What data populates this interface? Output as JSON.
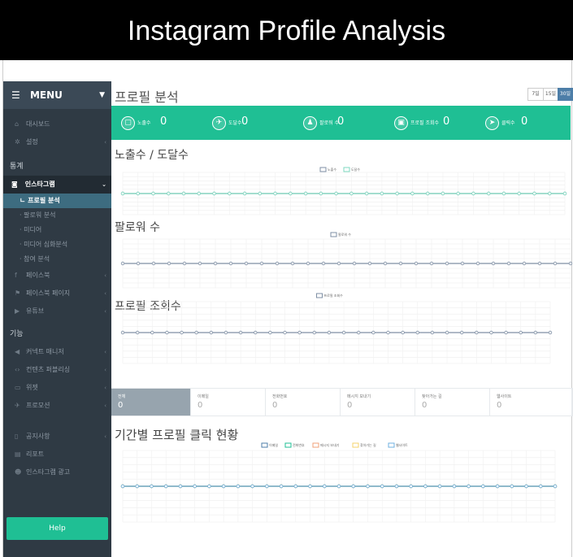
{
  "banner": {
    "title": "Instagram Profile Analysis"
  },
  "sidebar": {
    "menu_label": "MENU",
    "items_top": [
      {
        "icon": "home-icon",
        "glyph": "⌂",
        "label": "대시보드"
      },
      {
        "icon": "gear-icon",
        "glyph": "✲",
        "label": "설정"
      }
    ],
    "section_stats": "통계",
    "instagram": {
      "label": "인스타그램"
    },
    "instagram_sub": [
      "프로필 분석",
      "팔로워 분석",
      "미디어",
      "미디어 심화분석",
      "참여 분석"
    ],
    "items_mid": [
      {
        "icon": "facebook-icon",
        "glyph": "f",
        "label": "페이스북"
      },
      {
        "icon": "flag-icon",
        "glyph": "⚑",
        "label": "페이스북 페이지"
      },
      {
        "icon": "youtube-icon",
        "glyph": "▶",
        "label": "유튜브"
      }
    ],
    "section_features": "기능",
    "items_features": [
      {
        "icon": "megaphone-icon",
        "glyph": "◀",
        "label": "커넥트 매니저"
      },
      {
        "icon": "code-icon",
        "glyph": "‹›",
        "label": "컨텐츠 퍼블리싱"
      },
      {
        "icon": "chat-icon",
        "glyph": "▭",
        "label": "위젯"
      },
      {
        "icon": "rocket-icon",
        "glyph": "✈",
        "label": "프로모션"
      }
    ],
    "items_bottom": [
      {
        "icon": "document-icon",
        "glyph": "▯",
        "label": "공지사항"
      },
      {
        "icon": "report-icon",
        "glyph": "▤",
        "label": "리포트"
      },
      {
        "icon": "users-icon",
        "glyph": "☻",
        "label": "인스타그램 광고"
      }
    ],
    "help_label": "Help"
  },
  "page": {
    "title": "프로필 분석",
    "ranges": [
      "7일",
      "15일",
      "30일"
    ],
    "active_range": "30일"
  },
  "stats_bar": [
    {
      "icon": "tablet-icon",
      "glyph": "▢",
      "label": "노출수",
      "value": "0"
    },
    {
      "icon": "plane-icon",
      "glyph": "✈",
      "label": "도달수",
      "value": "0"
    },
    {
      "icon": "user-icon",
      "glyph": "♟",
      "label": "팔로워 수",
      "value": "0"
    },
    {
      "icon": "id-card-icon",
      "glyph": "▣",
      "label": "프로필 조회수",
      "value": "0"
    },
    {
      "icon": "cursor-icon",
      "glyph": "➤",
      "label": "클릭수",
      "value": "0"
    }
  ],
  "sections": {
    "impressions": "노출수 / 도달수",
    "followers": "팔로워 수",
    "profile_views": "프로필 조회수",
    "clicks": "기간별 프로필 클릭 현황"
  },
  "click_breakdown": [
    {
      "label": "전체",
      "value": "0"
    },
    {
      "label": "이메일",
      "value": "0"
    },
    {
      "label": "전화번호",
      "value": "0"
    },
    {
      "label": "메시지 보내기",
      "value": "0"
    },
    {
      "label": "찾아가는 길",
      "value": "0"
    },
    {
      "label": "웹사이트",
      "value": "0"
    }
  ],
  "chart_data": [
    {
      "type": "line",
      "series": [
        {
          "name": "노출수",
          "values": [
            0,
            0,
            0,
            0,
            0,
            0,
            0,
            0,
            0,
            0,
            0,
            0,
            0,
            0,
            0,
            0,
            0,
            0,
            0,
            0,
            0,
            0,
            0,
            0,
            0,
            0,
            0,
            0,
            0,
            0
          ]
        },
        {
          "name": "도달수",
          "values": [
            0,
            0,
            0,
            0,
            0,
            0,
            0,
            0,
            0,
            0,
            0,
            0,
            0,
            0,
            0,
            0,
            0,
            0,
            0,
            0,
            0,
            0,
            0,
            0,
            0,
            0,
            0,
            0,
            0,
            0
          ]
        }
      ],
      "grid": true,
      "legend": "top-center",
      "colors": [
        "#7f8fa4",
        "#7fd9c0"
      ]
    },
    {
      "type": "line",
      "series": [
        {
          "name": "팔로워 수",
          "values": [
            0,
            0,
            0,
            0,
            0,
            0,
            0,
            0,
            0,
            0,
            0,
            0,
            0,
            0,
            0,
            0,
            0,
            0,
            0,
            0,
            0,
            0,
            0,
            0,
            0,
            0,
            0,
            0,
            0,
            0
          ]
        }
      ],
      "grid": true,
      "legend": "top-center",
      "colors": [
        "#7f8fa4"
      ]
    },
    {
      "type": "line",
      "series": [
        {
          "name": "프로필 조회수",
          "values": [
            0,
            0,
            0,
            0,
            0,
            0,
            0,
            0,
            0,
            0,
            0,
            0,
            0,
            0,
            0,
            0,
            0,
            0,
            0,
            0,
            0,
            0,
            0,
            0,
            0,
            0,
            0,
            0,
            0,
            0
          ]
        }
      ],
      "grid": true,
      "legend": "top-center",
      "colors": [
        "#7f8fa4"
      ]
    },
    {
      "type": "line",
      "series": [
        {
          "name": "이메일",
          "values": [
            0,
            0,
            0,
            0,
            0,
            0,
            0,
            0,
            0,
            0,
            0,
            0,
            0,
            0,
            0,
            0,
            0,
            0,
            0,
            0,
            0,
            0,
            0,
            0,
            0,
            0,
            0,
            0,
            0,
            0,
            0
          ]
        },
        {
          "name": "전화번호",
          "values": [
            0,
            0,
            0,
            0,
            0,
            0,
            0,
            0,
            0,
            0,
            0,
            0,
            0,
            0,
            0,
            0,
            0,
            0,
            0,
            0,
            0,
            0,
            0,
            0,
            0,
            0,
            0,
            0,
            0,
            0,
            0
          ]
        },
        {
          "name": "메시지 보내기",
          "values": [
            0,
            0,
            0,
            0,
            0,
            0,
            0,
            0,
            0,
            0,
            0,
            0,
            0,
            0,
            0,
            0,
            0,
            0,
            0,
            0,
            0,
            0,
            0,
            0,
            0,
            0,
            0,
            0,
            0,
            0,
            0
          ]
        },
        {
          "name": "찾아가는 길",
          "values": [
            0,
            0,
            0,
            0,
            0,
            0,
            0,
            0,
            0,
            0,
            0,
            0,
            0,
            0,
            0,
            0,
            0,
            0,
            0,
            0,
            0,
            0,
            0,
            0,
            0,
            0,
            0,
            0,
            0,
            0,
            0
          ]
        },
        {
          "name": "웹사이트",
          "values": [
            0,
            0,
            0,
            0,
            0,
            0,
            0,
            0,
            0,
            0,
            0,
            0,
            0,
            0,
            0,
            0,
            0,
            0,
            0,
            0,
            0,
            0,
            0,
            0,
            0,
            0,
            0,
            0,
            0,
            0,
            0
          ]
        }
      ],
      "grid": true,
      "legend": "top-center",
      "colors": [
        "#4d7ea8",
        "#1fbf94",
        "#f0a27a",
        "#f5d36b",
        "#6fb0e0"
      ]
    }
  ]
}
